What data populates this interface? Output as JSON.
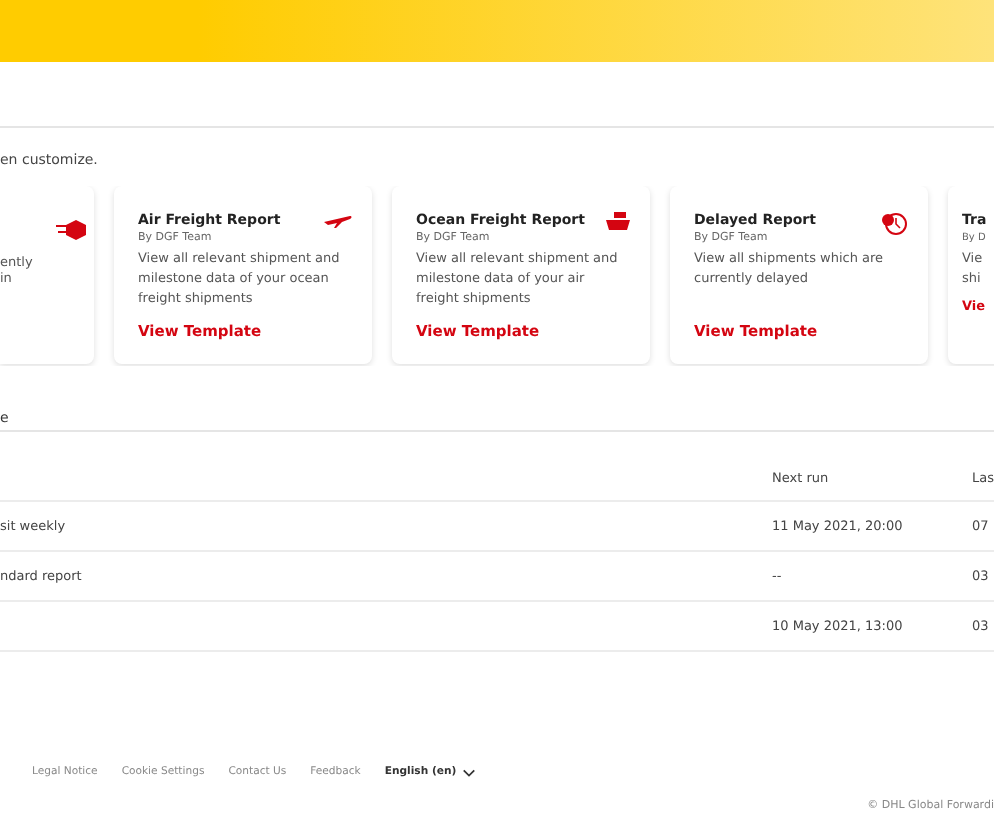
{
  "intro": "en customize.",
  "cards": [
    {
      "kind": "partial-left",
      "desc": "ently in"
    },
    {
      "kind": "full",
      "title": "Air Freight Report",
      "by": "By DGF Team",
      "desc": "View all relevant shipment and milestone data of your ocean freight shipments",
      "link": "View Template"
    },
    {
      "kind": "full",
      "title": "Ocean Freight Report",
      "by": "By DGF Team",
      "desc": "View all relevant shipment and milestone data of your air freight shipments",
      "link": "View Template"
    },
    {
      "kind": "full",
      "title": "Delayed Report",
      "by": "By DGF Team",
      "desc": "View all shipments which are currently delayed",
      "link": "View Template"
    },
    {
      "kind": "partial-right",
      "title": "Tra",
      "by": "By D",
      "desc": "Vie",
      "desc2": "shi",
      "link": "Vie"
    }
  ],
  "section_heading": "e",
  "table": {
    "columns": [
      "",
      "Next run",
      "Las"
    ],
    "rows": [
      {
        "name": "sit weekly",
        "next_run": "11 May 2021, 20:00",
        "last": "07"
      },
      {
        "name": "ndard report",
        "next_run": "--",
        "last": "03"
      },
      {
        "name": "",
        "next_run": "10 May 2021, 13:00",
        "last": "03"
      }
    ]
  },
  "footer": {
    "links": [
      "Legal Notice",
      "Cookie Settings",
      "Contact Us",
      "Feedback"
    ],
    "language": "English (en)",
    "copyright": "© DHL Global Forwardi"
  }
}
